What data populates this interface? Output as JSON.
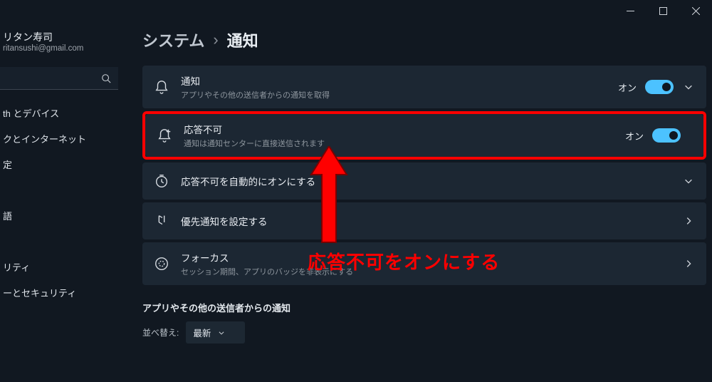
{
  "window": {
    "controls": [
      "minimize",
      "maximize",
      "close"
    ]
  },
  "user": {
    "name": "リタン寿司",
    "email": "ritansushi@gmail.com"
  },
  "search": {
    "placeholder": ""
  },
  "nav": {
    "items": [
      "th とデバイス",
      "クとインターネット",
      "定",
      "",
      "語",
      "",
      "リティ",
      "ーとセキュリティ"
    ]
  },
  "breadcrumb": {
    "parent": "システム",
    "sep": "›",
    "current": "通知"
  },
  "rows": {
    "notify": {
      "title": "通知",
      "sub": "アプリやその他の送信者からの通知を取得",
      "state": "オン"
    },
    "dnd": {
      "title": "応答不可",
      "sub": "通知は通知センターに直接送信されます",
      "state": "オン"
    },
    "auto_dnd": {
      "title": "応答不可を自動的にオンにする"
    },
    "priority": {
      "title": "優先通知を設定する"
    },
    "focus": {
      "title": "フォーカス",
      "sub": "セッション期間、アプリのバッジを非表示にする"
    }
  },
  "section": {
    "title": "アプリやその他の送信者からの通知",
    "sort_label": "並べ替え:",
    "sort_value": "最新"
  },
  "annotation": {
    "text": "応答不可をオンにする"
  }
}
